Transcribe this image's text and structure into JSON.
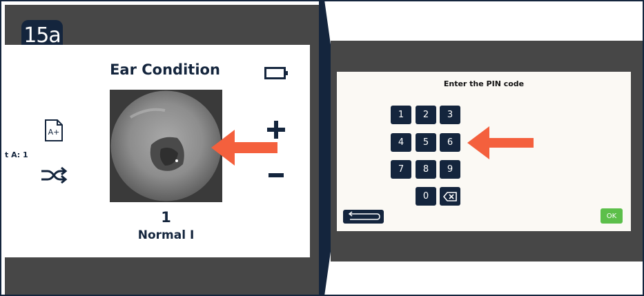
{
  "step_badge": "15a",
  "left_screen": {
    "title": "Ear Condition",
    "score_value": "1",
    "score_label": "Normal I",
    "ear_indicator": "t A:  1",
    "icons": [
      "battery-icon",
      "plus-icon",
      "minus-icon",
      "grade-a-plus-icon",
      "shuffle-icon",
      "ear-image"
    ]
  },
  "pin_screen": {
    "title": "Enter the PIN code",
    "keys": [
      "1",
      "2",
      "3",
      "4",
      "5",
      "6",
      "7",
      "8",
      "9",
      "0"
    ],
    "ok_label": "OK",
    "icons": [
      "backspace-icon",
      "back-arrow-icon"
    ]
  },
  "colors": {
    "navy": "#14253d",
    "dark_gray": "#474747",
    "arrow_orange": "#f4603d",
    "ok_green": "#5cbf4a",
    "screen_cream": "#fbf9f4"
  }
}
